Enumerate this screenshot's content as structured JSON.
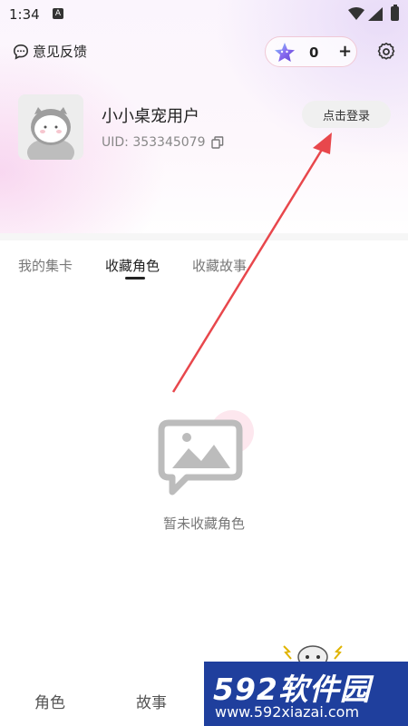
{
  "status_bar": {
    "time": "1:34",
    "a_badge": "A"
  },
  "header": {
    "feedback_label": "意见反馈",
    "coin_count": "0",
    "plus_label": "+"
  },
  "profile": {
    "name": "小小桌宠用户",
    "uid": "UID: 353345079",
    "login_label": "点击登录"
  },
  "tabs": [
    {
      "label": "我的集卡",
      "active": false
    },
    {
      "label": "收藏角色",
      "active": true
    },
    {
      "label": "收藏故事",
      "active": false
    }
  ],
  "empty_state": {
    "text": "暂未收藏角色"
  },
  "bottom_nav": [
    {
      "label": "角色"
    },
    {
      "label": "故事"
    }
  ],
  "watermark": {
    "brand": "592软件园",
    "url": "www.592xiazai.com"
  },
  "colors": {
    "accent_arrow": "#e8474c",
    "pill_border": "#f0c9d6",
    "watermark_bg": "#1f3f9d"
  },
  "icons": [
    "feedback-icon",
    "star-icon",
    "gear-icon",
    "copy-icon",
    "image-placeholder-icon",
    "mascot-icon",
    "wifi-icon",
    "signal-icon",
    "battery-icon"
  ]
}
